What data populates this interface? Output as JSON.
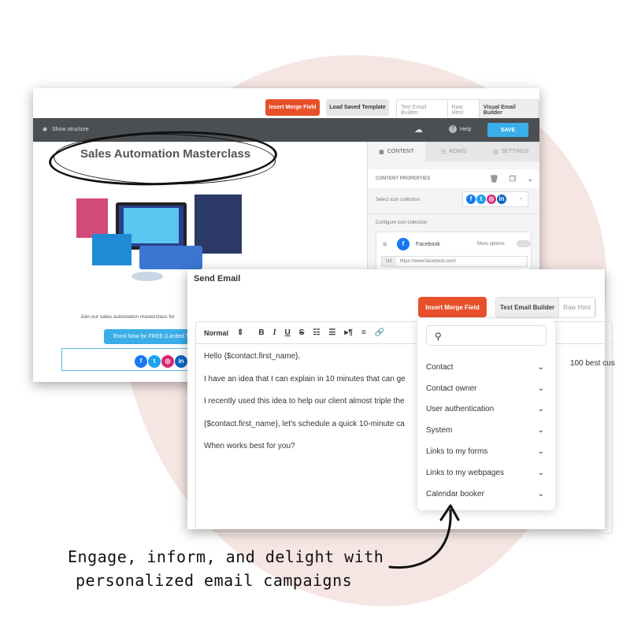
{
  "builder": {
    "insert_merge_field": "Insert Merge Field",
    "load_saved_template": "Load Saved Template",
    "modes": [
      "Text Email Builder",
      "Raw Html",
      "Visual Email Builder"
    ],
    "show_structure": "Show structure",
    "help": "Help",
    "save": "SAVE",
    "email_title": "Sales Automation Masterclass",
    "join_text": "Join our sales automation masterclass for",
    "enrol_button": "Enrol Now for FREE (Limited T",
    "panel": {
      "tabs": [
        "CONTENT",
        "ROWS",
        "SETTINGS"
      ],
      "content_properties": "CONTENT PROPERTIES",
      "select_icon_collection": "Select icon collection",
      "configure_icon_collection": "Configure icon collection",
      "facebook": "Facebook",
      "more_options": "More options",
      "url_label": "Url",
      "url_value": "https://www.facebook.com/"
    }
  },
  "send_email": {
    "title": "Send Email",
    "insert_merge_field": "Insert Merge Field",
    "modes": [
      "Text Email Builder",
      "Raw Html"
    ],
    "format": "Normal",
    "body": [
      "Hello {$contact.first_name},",
      "I have an idea that I can explain in 10 minutes that can ge",
      "I recently used this idea to help our client almost triple the",
      "{$contact.first_name}, let's schedule a quick 10-minute ca",
      "When works best for you?"
    ],
    "body_overflow": "100 best cus",
    "merge_menu": {
      "search_placeholder": "",
      "items": [
        "Contact",
        "Contact owner",
        "User authentication",
        "System",
        "Links to my forms",
        "Links to my webpages",
        "Calendar booker"
      ]
    }
  },
  "tagline": [
    "Engage, inform, and delight with",
    "personalized email campaigns"
  ],
  "colors": {
    "accent": "#e8502a",
    "save": "#3aaee8",
    "dark_bar": "#4b4f52",
    "blob": "#f6e6e3"
  }
}
